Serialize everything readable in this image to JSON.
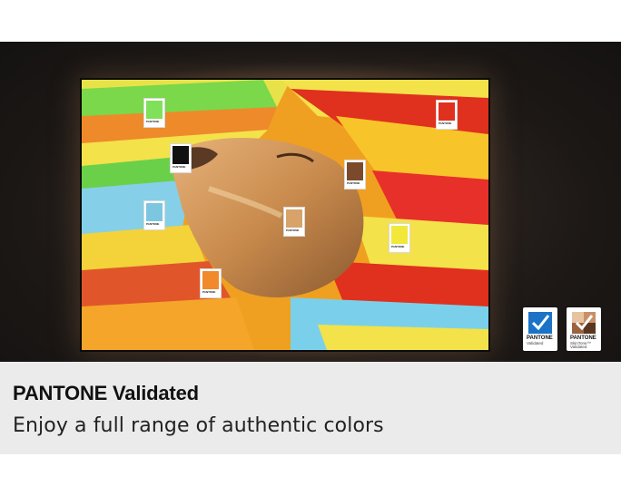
{
  "caption": {
    "title": "PANTONE Validated",
    "subtitle": "Enjoy a full range of authentic colors"
  },
  "swatches": [
    {
      "id": "green",
      "brand": "PANTONE",
      "color": "#7fe05a"
    },
    {
      "id": "black",
      "brand": "PANTONE",
      "color": "#111111"
    },
    {
      "id": "blue",
      "brand": "PANTONE",
      "color": "#7cc7df"
    },
    {
      "id": "orange",
      "brand": "PANTONE",
      "color": "#f08a2a"
    },
    {
      "id": "tan",
      "brand": "PANTONE",
      "color": "#d7a36a"
    },
    {
      "id": "brown",
      "brand": "PANTONE",
      "color": "#7a4a2a"
    },
    {
      "id": "red",
      "brand": "PANTONE",
      "color": "#e0301e"
    },
    {
      "id": "yellow",
      "brand": "PANTONE",
      "color": "#f1e83a"
    }
  ],
  "badges": {
    "pantone": {
      "brand": "PANTONE",
      "line1": "Validated",
      "line2": "",
      "mark_color": "#1a73c7"
    },
    "skintone": {
      "brand": "PANTONE",
      "line1": "SkinTone™",
      "line2": "Validated",
      "mark_color": "#8a5a3a"
    }
  }
}
